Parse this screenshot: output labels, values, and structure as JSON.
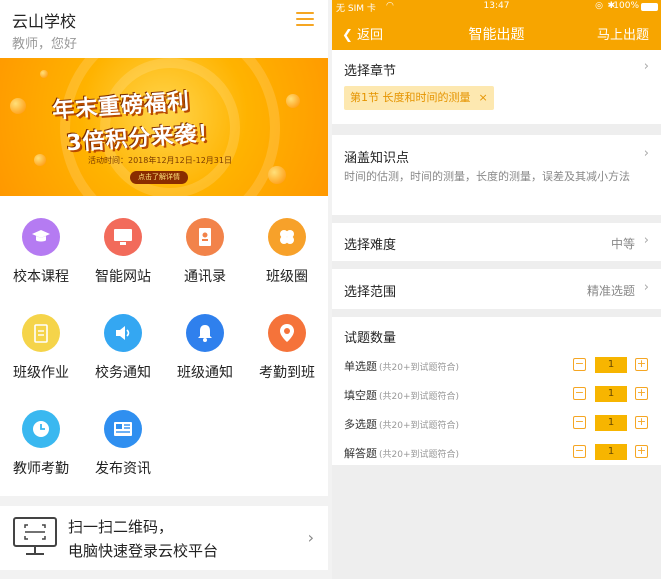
{
  "left": {
    "school_name": "云山学校",
    "greeting": "教师，您好",
    "banner": {
      "title_line1": "年末重磅福利",
      "title_line2": "3倍积分来袭！",
      "date": "活动时间：2018年12月12日-12月31日",
      "button": "点击了解详情"
    },
    "apps": [
      {
        "label": "校本课程",
        "icon": "graduation-cap-icon",
        "color": "#b57bf2"
      },
      {
        "label": "智能网站",
        "icon": "monitor-icon",
        "color": "#f26b5b"
      },
      {
        "label": "通讯录",
        "icon": "contacts-book-icon",
        "color": "#f2834a"
      },
      {
        "label": "班级圈",
        "icon": "clover-icon",
        "color": "#f7a12a"
      },
      {
        "label": "班级作业",
        "icon": "clipboard-icon",
        "color": "#f5d44a"
      },
      {
        "label": "校务通知",
        "icon": "speaker-icon",
        "color": "#34a7f2"
      },
      {
        "label": "班级通知",
        "icon": "bell-icon",
        "color": "#2f80ed"
      },
      {
        "label": "考勤到班",
        "icon": "location-pin-icon",
        "color": "#f5733a"
      },
      {
        "label": "教师考勤",
        "icon": "clock-icon",
        "color": "#3ab8f0"
      },
      {
        "label": "发布资讯",
        "icon": "newspaper-icon",
        "color": "#2f8ff0"
      }
    ],
    "qr": {
      "line1": "扫一扫二维码，",
      "line2": "电脑快速登录云校平台"
    }
  },
  "right": {
    "status": {
      "carrier": "无 SIM 卡",
      "time": "13:47",
      "battery": "100%"
    },
    "nav": {
      "back": "返回",
      "title": "智能出题",
      "action": "马上出题"
    },
    "chapter": {
      "label": "选择章节",
      "tag": "第1节  长度和时间的测量",
      "tag_remove": "×"
    },
    "knowledge": {
      "label": "涵盖知识点",
      "desc": "时间的估测，时间的测量，长度的测量，误差及其减小方法"
    },
    "difficulty": {
      "label": "选择难度",
      "value": "中等"
    },
    "scope": {
      "label": "选择范围",
      "value": "精准选题"
    },
    "quantity": {
      "label": "试题数量",
      "rows": [
        {
          "name": "单选题",
          "hint": "(共20+到试题符合)",
          "value": "1"
        },
        {
          "name": "填空题",
          "hint": "(共20+到试题符合)",
          "value": "1"
        },
        {
          "name": "多选题",
          "hint": "(共20+到试题符合)",
          "value": "1"
        },
        {
          "name": "解答题",
          "hint": "(共20+到试题符合)",
          "value": "1"
        }
      ]
    }
  }
}
